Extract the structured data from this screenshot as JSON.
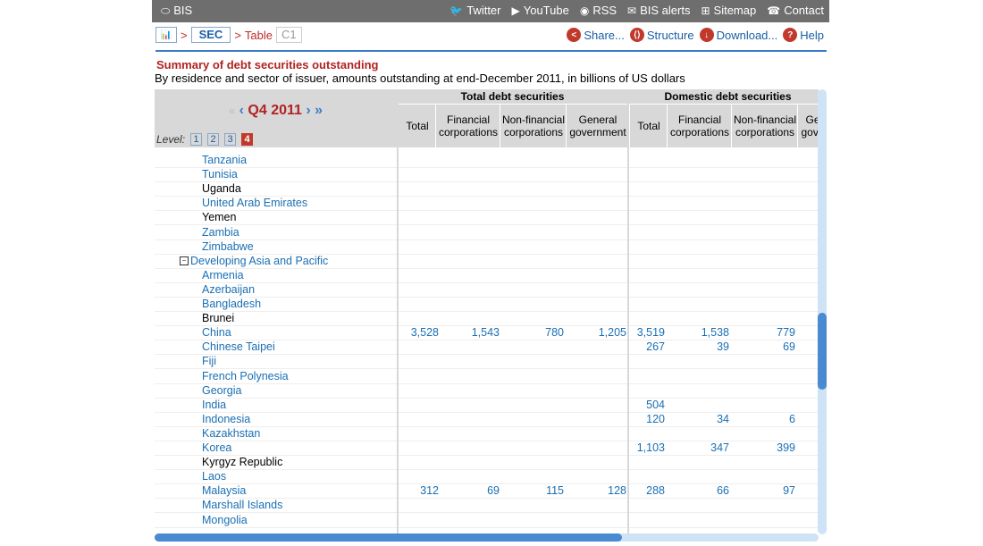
{
  "topbar": {
    "logo": "BIS",
    "links": [
      {
        "label": "Twitter",
        "icon": "twitter-icon",
        "glyph": "🐦"
      },
      {
        "label": "YouTube",
        "icon": "youtube-icon",
        "glyph": "▶"
      },
      {
        "label": "RSS",
        "icon": "rss-icon",
        "glyph": "◉"
      },
      {
        "label": "BIS alerts",
        "icon": "mail-icon",
        "glyph": "✉"
      },
      {
        "label": "Sitemap",
        "icon": "sitemap-icon",
        "glyph": "⊞"
      },
      {
        "label": "Contact",
        "icon": "phone-icon",
        "glyph": "☎"
      }
    ]
  },
  "breadcrumb": {
    "sep": ">",
    "sec": "SEC",
    "table": "Table",
    "c1": "C1"
  },
  "actions": {
    "share": "Share...",
    "structure": "Structure",
    "download": "Download...",
    "help": "Help"
  },
  "title": "Summary of debt securities outstanding",
  "subtitle": "By residence and sector of issuer, amounts outstanding at end-December 2011, in billions of US dollars",
  "period": {
    "label": "Q4 2011",
    "first": "«",
    "prev": "‹",
    "next": "›",
    "last": "»"
  },
  "level": {
    "label": "Level:",
    "options": [
      "1",
      "2",
      "3",
      "4"
    ],
    "active": "4"
  },
  "groups": {
    "total": "Total debt securities",
    "domestic": "Domestic debt securities"
  },
  "columns": [
    "Total",
    "Financial corporations",
    "Non-financial corporations",
    "General government",
    "Total",
    "Financial corporations",
    "Non-financial corporations",
    "Ge gove"
  ],
  "rows": [
    {
      "name": "Tanzania",
      "link": true,
      "vals": [
        "",
        "",
        "",
        "",
        "",
        "",
        ""
      ]
    },
    {
      "name": "Tunisia",
      "link": true,
      "vals": [
        "",
        "",
        "",
        "",
        "",
        "",
        ""
      ]
    },
    {
      "name": "Uganda",
      "link": false,
      "vals": [
        "",
        "",
        "",
        "",
        "",
        "",
        ""
      ]
    },
    {
      "name": "United Arab Emirates",
      "link": true,
      "vals": [
        "",
        "",
        "",
        "",
        "",
        "",
        ""
      ]
    },
    {
      "name": "Yemen",
      "link": false,
      "vals": [
        "",
        "",
        "",
        "",
        "",
        "",
        ""
      ]
    },
    {
      "name": "Zambia",
      "link": true,
      "vals": [
        "",
        "",
        "",
        "",
        "",
        "",
        ""
      ]
    },
    {
      "name": "Zimbabwe",
      "link": true,
      "vals": [
        "",
        "",
        "",
        "",
        "",
        "",
        ""
      ]
    },
    {
      "name": "Developing Asia and Pacific",
      "link": true,
      "group": true,
      "vals": [
        "",
        "",
        "",
        "",
        "",
        "",
        ""
      ]
    },
    {
      "name": "Armenia",
      "link": true,
      "vals": [
        "",
        "",
        "",
        "",
        "",
        "",
        ""
      ]
    },
    {
      "name": "Azerbaijan",
      "link": true,
      "vals": [
        "",
        "",
        "",
        "",
        "",
        "",
        ""
      ]
    },
    {
      "name": "Bangladesh",
      "link": true,
      "vals": [
        "",
        "",
        "",
        "",
        "",
        "",
        ""
      ]
    },
    {
      "name": "Brunei",
      "link": false,
      "vals": [
        "",
        "",
        "",
        "",
        "",
        "",
        ""
      ]
    },
    {
      "name": "China",
      "link": true,
      "vals": [
        "3,528",
        "1,543",
        "780",
        "1,205",
        "3,519",
        "1,538",
        "779"
      ]
    },
    {
      "name": "Chinese Taipei",
      "link": true,
      "vals": [
        "",
        "",
        "",
        "",
        "267",
        "39",
        "69"
      ]
    },
    {
      "name": "Fiji",
      "link": true,
      "vals": [
        "",
        "",
        "",
        "",
        "",
        "",
        ""
      ]
    },
    {
      "name": "French Polynesia",
      "link": true,
      "vals": [
        "",
        "",
        "",
        "",
        "",
        "",
        ""
      ]
    },
    {
      "name": "Georgia",
      "link": true,
      "vals": [
        "",
        "",
        "",
        "",
        "",
        "",
        ""
      ]
    },
    {
      "name": "India",
      "link": true,
      "vals": [
        "",
        "",
        "",
        "",
        "504",
        "",
        ""
      ]
    },
    {
      "name": "Indonesia",
      "link": true,
      "vals": [
        "",
        "",
        "",
        "",
        "120",
        "34",
        "6"
      ]
    },
    {
      "name": "Kazakhstan",
      "link": true,
      "vals": [
        "",
        "",
        "",
        "",
        "",
        "",
        ""
      ]
    },
    {
      "name": "Korea",
      "link": true,
      "vals": [
        "",
        "",
        "",
        "",
        "1,103",
        "347",
        "399"
      ]
    },
    {
      "name": "Kyrgyz Republic",
      "link": false,
      "vals": [
        "",
        "",
        "",
        "",
        "",
        "",
        ""
      ]
    },
    {
      "name": "Laos",
      "link": true,
      "vals": [
        "",
        "",
        "",
        "",
        "",
        "",
        ""
      ]
    },
    {
      "name": "Malaysia",
      "link": true,
      "vals": [
        "312",
        "69",
        "115",
        "128",
        "288",
        "66",
        "97"
      ]
    },
    {
      "name": "Marshall Islands",
      "link": true,
      "vals": [
        "",
        "",
        "",
        "",
        "",
        "",
        ""
      ]
    },
    {
      "name": "Mongolia",
      "link": true,
      "vals": [
        "",
        "",
        "",
        "",
        "",
        "",
        ""
      ]
    }
  ]
}
